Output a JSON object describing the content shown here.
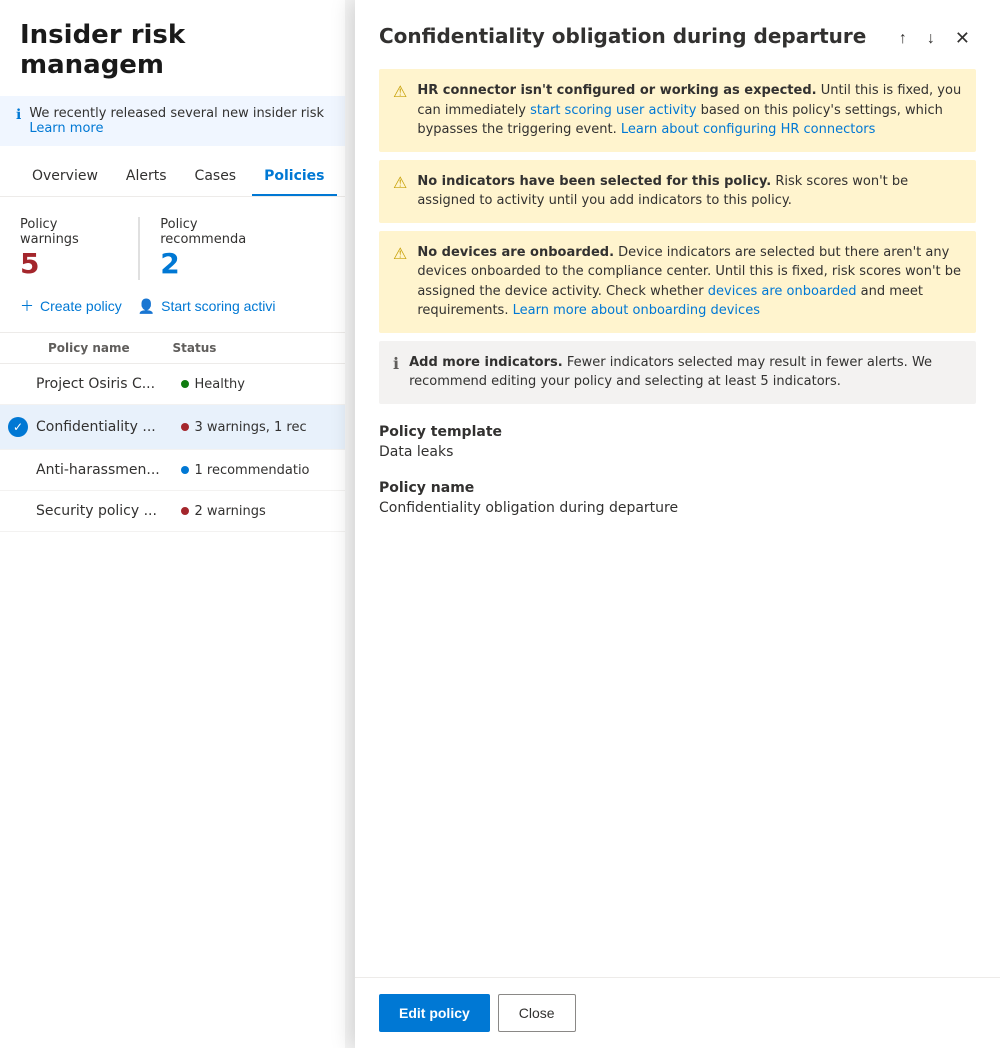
{
  "page": {
    "title": "Insider risk managem"
  },
  "banner": {
    "text": "We recently released several new insider risk ",
    "link_text": "Learn more"
  },
  "nav": {
    "tabs": [
      "Overview",
      "Alerts",
      "Cases",
      "Policies"
    ]
  },
  "stats": {
    "warnings_label": "Policy warnings",
    "warnings_value": "5",
    "recommendations_label": "Policy recommenda",
    "recommendations_value": "2"
  },
  "actions": {
    "create_policy": "Create policy",
    "start_scoring": "Start scoring activi"
  },
  "table": {
    "headers": [
      "Policy name",
      "Status"
    ],
    "rows": [
      {
        "name": "Project Osiris C...",
        "status": "Healthy",
        "dot": "green",
        "selected": false
      },
      {
        "name": "Confidentiality ...",
        "status": "3 warnings, 1 rec",
        "dot": "red",
        "selected": true
      },
      {
        "name": "Anti-harassmen...",
        "status": "1 recommendatio",
        "dot": "blue",
        "selected": false
      },
      {
        "name": "Security policy ...",
        "status": "2 warnings",
        "dot": "red",
        "selected": false
      }
    ]
  },
  "panel": {
    "title": "Confidentiality obligation during departure",
    "nav_up": "↑",
    "nav_down": "↓",
    "close": "✕",
    "alerts": [
      {
        "type": "warning",
        "bold": "HR connector isn't configured or working as expected.",
        "text_before": "",
        "text_after": " Until this is fixed, you can immediately ",
        "link1_text": "start scoring user activity",
        "text_middle": " based on this policy's settings, which bypasses the triggering event. ",
        "link2_text": "Learn about configuring HR connectors",
        "text_end": ""
      },
      {
        "type": "warning",
        "bold": "No indicators have been selected for this policy.",
        "text_after": " Risk scores won't be assigned to activity until you add indicators to this policy."
      },
      {
        "type": "warning",
        "bold": "No devices are onboarded.",
        "text_after": " Device indicators are selected but there aren't any devices onboarded to the compliance center. Until this is fixed, risk scores won't be assigned the device activity. Check whether ",
        "link1_text": "devices are onboarded",
        "text_middle": " and meet requirements. ",
        "link2_text": "Learn more about onboarding devices",
        "text_end": ""
      },
      {
        "type": "info",
        "bold": "Add more indicators.",
        "text_after": " Fewer indicators selected may result in fewer alerts. We recommend editing your policy and selecting at least 5 indicators."
      }
    ],
    "policy_template_label": "Policy template",
    "policy_template_value": "Data leaks",
    "policy_name_label": "Policy name",
    "policy_name_value": "Confidentiality obligation during departure",
    "footer": {
      "edit_label": "Edit policy",
      "close_label": "Close"
    }
  }
}
